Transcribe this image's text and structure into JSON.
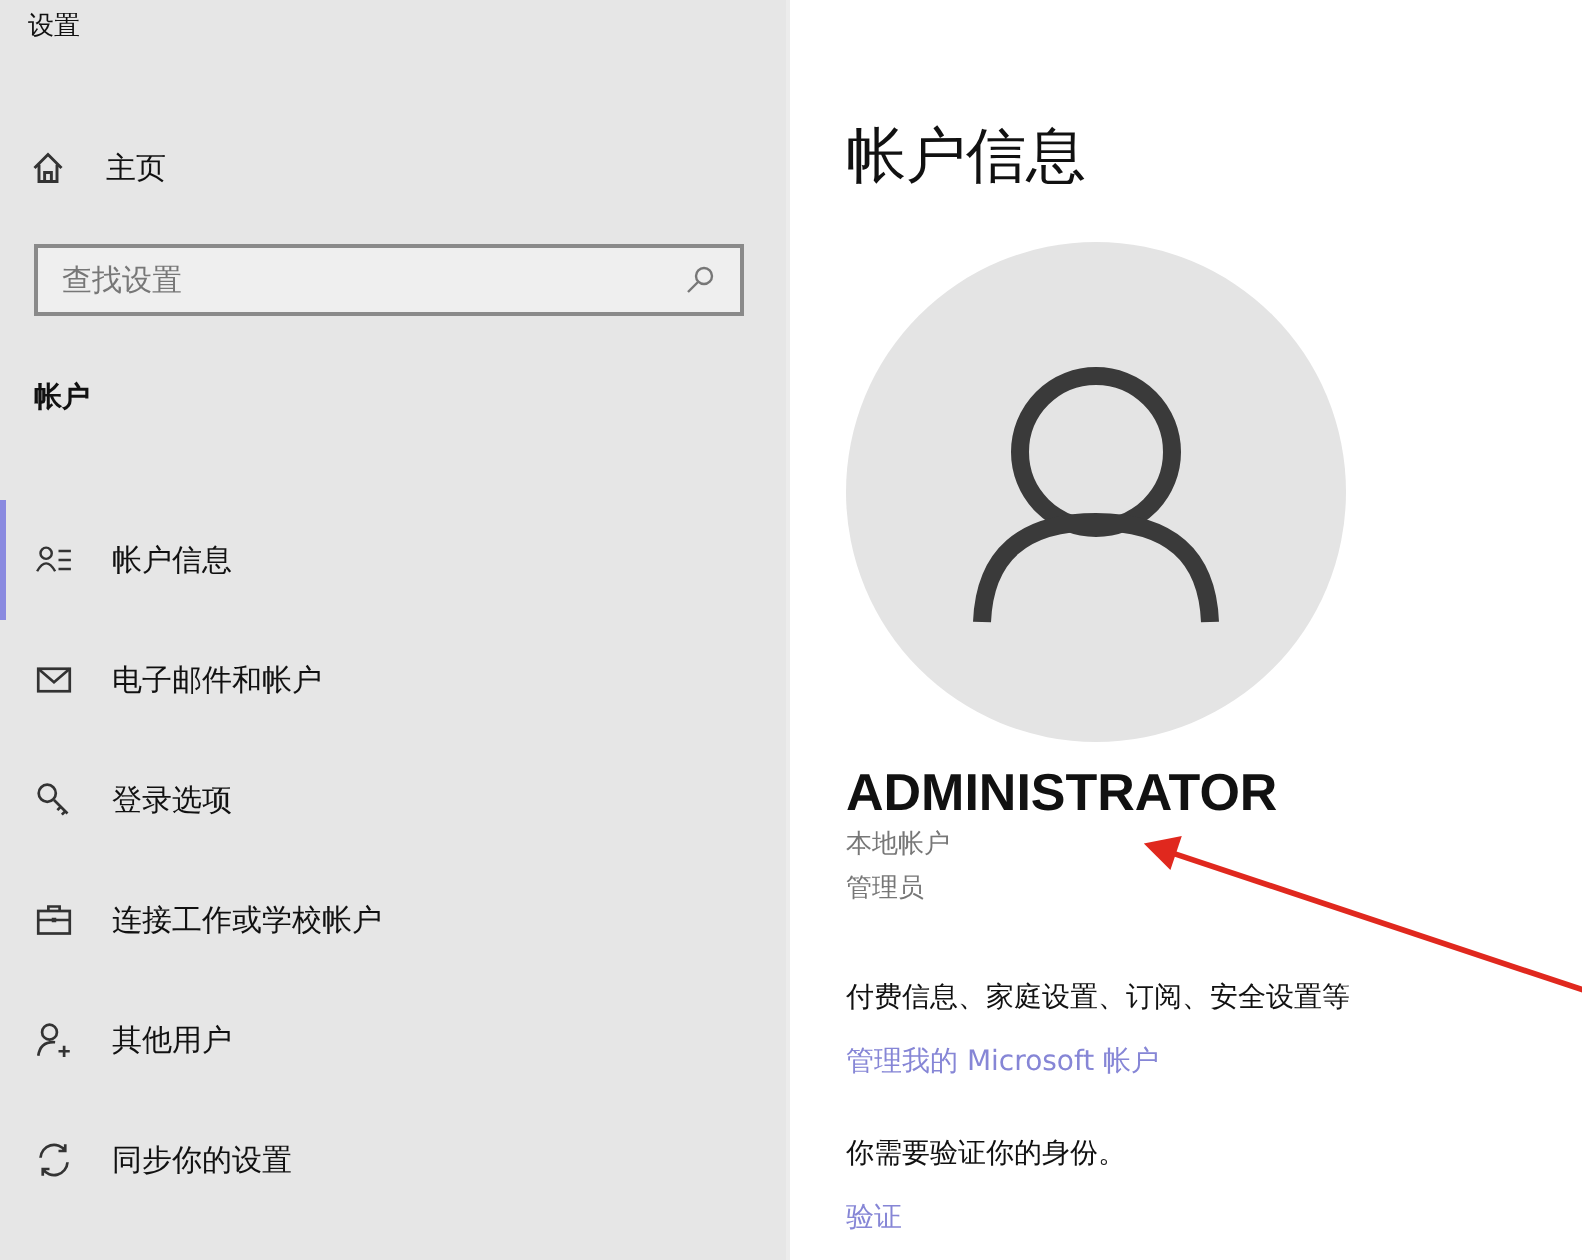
{
  "window": {
    "title": "设置"
  },
  "home": {
    "label": "主页"
  },
  "search": {
    "placeholder": "查找设置"
  },
  "section": {
    "title": "帐户"
  },
  "nav": [
    {
      "kind": "account",
      "label": "帐户信息",
      "selected": true
    },
    {
      "kind": "mail",
      "label": "电子邮件和帐户",
      "selected": false
    },
    {
      "kind": "key",
      "label": "登录选项",
      "selected": false
    },
    {
      "kind": "briefcase",
      "label": "连接工作或学校帐户",
      "selected": false
    },
    {
      "kind": "adduser",
      "label": "其他用户",
      "selected": false
    },
    {
      "kind": "sync",
      "label": "同步你的设置",
      "selected": false
    }
  ],
  "page": {
    "title": "帐户信息",
    "user_name": "ADMINISTRATOR",
    "account_type": "本地帐户",
    "role": "管理员",
    "billing_text": "付费信息、家庭设置、订阅、安全设置等",
    "manage_link": "管理我的 Microsoft 帐户",
    "verify_text": "你需要验证你的身份。",
    "verify_link": "验证"
  }
}
